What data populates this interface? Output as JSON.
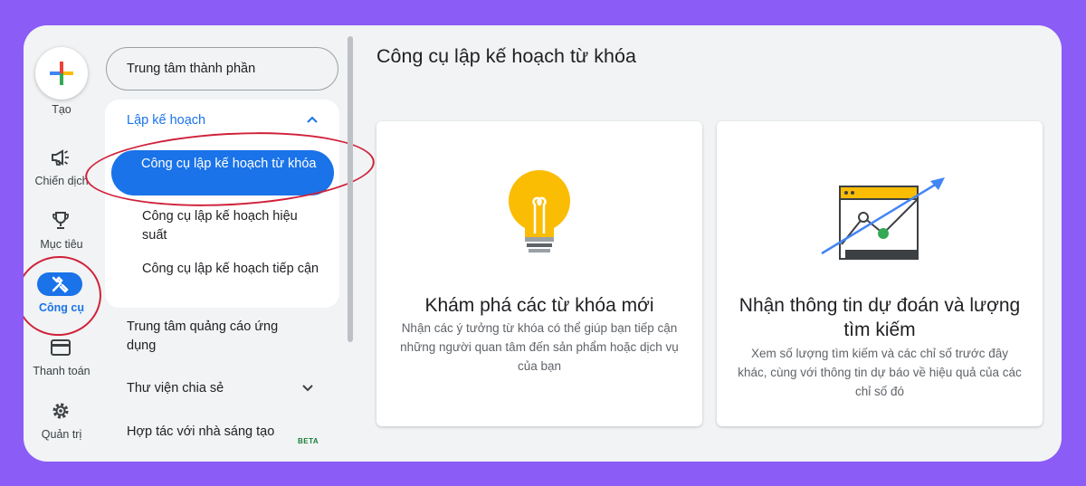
{
  "rail": {
    "create_label": "Tạo",
    "campaigns_label": "Chiến dịch",
    "goals_label": "Mục tiêu",
    "tools_label": "Công cụ",
    "billing_label": "Thanh toán",
    "admin_label": "Quản trị"
  },
  "nav": {
    "component_center": "Trung tâm thành phần",
    "planning_header": "Lập kế hoạch",
    "planning_items": [
      "Công cụ lập kế hoạch từ khóa",
      "Công cụ lập kế hoạch hiệu suất",
      "Công cụ lập kế hoạch tiếp cận"
    ],
    "app_ads_hub": "Trung tâm quảng cáo ứng dụng",
    "shared_library": "Thư viện chia sẻ",
    "creator_partnerships": "Hợp tác với nhà sáng tạo",
    "beta_badge": "BETA"
  },
  "main": {
    "title": "Công cụ lập kế hoạch từ khóa",
    "cards": [
      {
        "title": "Khám phá các từ khóa mới",
        "description": "Nhận các ý tưởng từ khóa có thể giúp bạn tiếp cận những người quan tâm đến sản phẩm hoặc dịch vụ của bạn",
        "icon": "lightbulb-icon"
      },
      {
        "title": "Nhận thông tin dự đoán và lượng tìm kiếm",
        "description": "Xem số lượng tìm kiếm và các chỉ số trước đây khác, cùng với thông tin dự báo về hiệu quả của các chỉ số đó",
        "icon": "trend-chart-icon"
      }
    ]
  },
  "colors": {
    "background": "#8b5cf6",
    "accent": "#1a73e8",
    "annotation_red": "#d0213a",
    "bulb_yellow": "#fbbc04"
  }
}
